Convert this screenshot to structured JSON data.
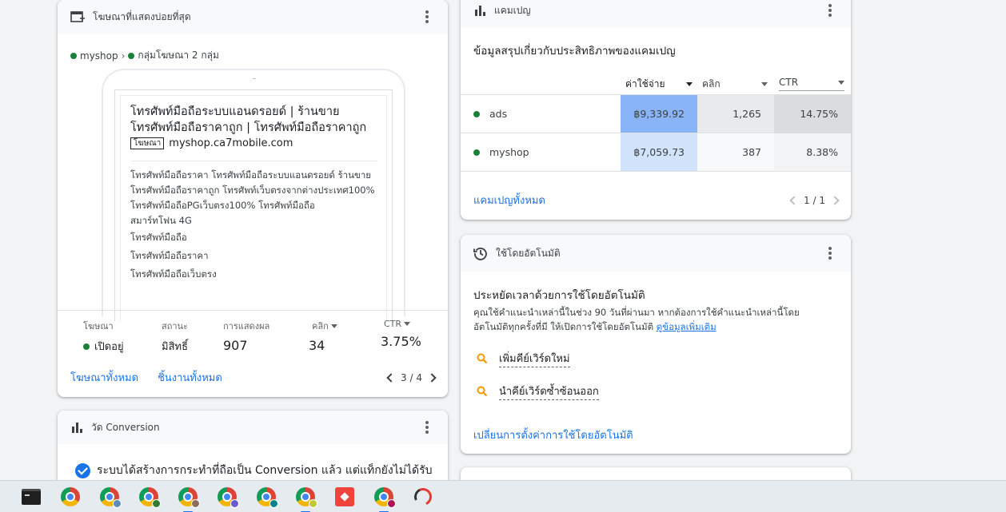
{
  "ads_card": {
    "title": "โฆษณาที่แสดงบ่อยที่สุด",
    "crumb_campaign": "myshop",
    "crumb_sep": "›",
    "crumb_group": "กลุ่มโฆษณา 2 กลุ่ม",
    "ad": {
      "headline_1": "โทรศัพท์มือถือระบบแอนดรอยด์ | ร้านขาย",
      "headline_2": "โทรศัพท์มือถือราคาถูก | โทรศัพท์มือถือราคาถูก",
      "badge": "โฆษณา",
      "url": "myshop.ca7mobile.com",
      "description": "โทรศัพท์มือถือราคา โทรศัพท์มือถือระบบแอนดรอยด์ ร้านขายโทรศัพท์มือถือราคาถูก โทรศัพท์เว็บตรงจากต่างประเทศ100% โทรศัพท์มือถือPGเว็บตรง100% โทรศัพท์มือถือ",
      "line_1": "สมาร์ทโฟน 4G",
      "sitelinks": [
        "โทรศัพท์มือถือ",
        "โทรศัพท์มือถือราคา",
        "โทรศัพท์มือถือเว็บตรง"
      ]
    },
    "stats": {
      "ad_label": "โฆษณา",
      "ad_value": "เปิดอยู่",
      "status_label": "สถานะ",
      "status_value": "มิสิทธิ์",
      "impr_label": "การแสดงผล",
      "impr_value": "907",
      "clicks_label": "คลิก",
      "clicks_value": "34",
      "ctr_label": "CTR",
      "ctr_value": "3.75%"
    },
    "footer": {
      "all_ads": "โฆษณาทั้งหมด",
      "all_assets": "ชิ้นงานทั้งหมด",
      "pager": "3 / 4"
    }
  },
  "conversion_card": {
    "title": "วัด Conversion",
    "message": "ระบบได้สร้างการกระทำที่ถือเป็น Conversion แล้ว แต่แท็กยังไม่ได้รับ"
  },
  "campaign_card": {
    "title": "แคมเปญ",
    "subtitle": "ข้อมูลสรุปเกี่ยวกับประสิทธิภาพของแคมเปญ",
    "columns": {
      "cost": "ค่าใช้จ่าย",
      "clicks": "คลิก",
      "ctr": "CTR"
    },
    "rows": [
      {
        "name": "ads",
        "cost": "฿9,339.92",
        "clicks": "1,265",
        "ctr": "14.75%"
      },
      {
        "name": "myshop",
        "cost": "฿7,059.73",
        "clicks": "387",
        "ctr": "8.38%"
      }
    ],
    "all_campaigns": "แคมเปญทั้งหมด",
    "pager": "1 / 1"
  },
  "auto_card": {
    "title": "ใช้โดยอัตโนมัติ",
    "heading": "ประหยัดเวลาด้วยการใช้โดยอัตโนมัติ",
    "description": "คุณใช้คำแนะนำเหล่านี้ในช่วง 90 วันที่ผ่านมา หากต้องการใช้คำแนะนำเหล่านี้โดยอัตโนมัติทุกครั้งที่มี ให้เปิดการใช้โดยอัตโนมัติ",
    "learn_more": "ดูข้อมูลเพิ่มเติม",
    "items": [
      "เพิ่มคีย์เวิร์ดใหม่",
      "นำคีย์เวิร์ดซ้ำซ้อนออก"
    ],
    "change_link": "เปลี่ยนการตั้งค่าการใช้โดยอัตโนมัติ"
  },
  "colors": {
    "blue": "#1a73e8",
    "green": "#188038",
    "heat_dark": "#8ab4f8",
    "heat_light": "#d2e3fc",
    "heat_gray_dark": "#dadce0",
    "heat_gray_light": "#f1f3f4"
  },
  "taskbar": {
    "icons": [
      "terminal-icon",
      "chrome-icon",
      "chrome-profile-icon",
      "chrome-profile-icon",
      "chrome-profile-icon",
      "chrome-profile-icon",
      "chrome-profile-icon",
      "chrome-profile-icon",
      "anydesk-icon",
      "chrome-profile-icon",
      "arc-app-icon"
    ]
  }
}
